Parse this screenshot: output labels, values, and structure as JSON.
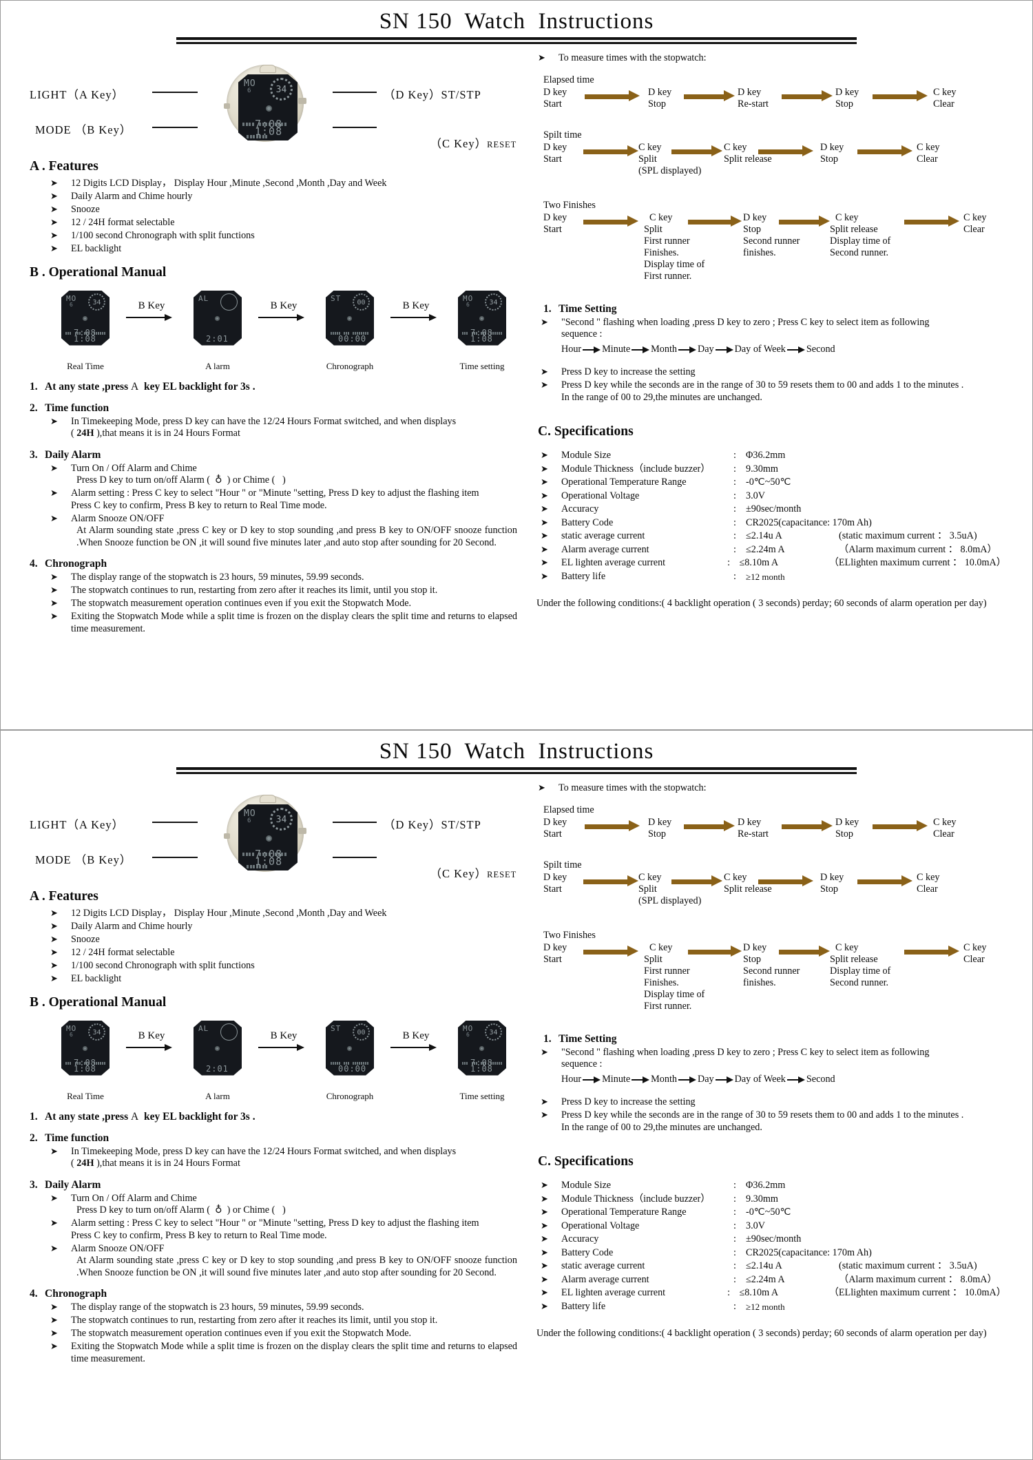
{
  "page": {
    "title": "SN 150  Watch  Instructions",
    "callout": {
      "light_label": "LIGHT（A Key）",
      "mode_label": "MODE （B Key）",
      "d_label": "（D Key）ST/STP",
      "c_label": "（C Key）",
      "c_label_small": "RESET",
      "lcd": {
        "mode_text": "MO",
        "small_text": "6",
        "ring_text": "34",
        "time_text": "7:08",
        "time_text2": "1:08"
      }
    },
    "features": {
      "heading": "A . Features",
      "items": [
        "12 Digits LCD Display， Display Hour ,Minute ,Second ,Month ,Day and Week",
        "Daily Alarm and Chime hourly",
        "Snooze",
        "12 / 24H format selectable",
        "1/100 second Chronograph with split functions",
        "EL backlight"
      ]
    },
    "manual": {
      "heading": "B . Operational Manual",
      "flow": [
        {
          "caption": "Real Time",
          "mode": "MO",
          "small": "6",
          "ring": "34",
          "time": "7:08",
          "time2": "1:08",
          "dotted": true
        },
        {
          "caption": "A larm",
          "mode": "AL",
          "small": "",
          "ring": "",
          "time": "2:01",
          "time2": "",
          "dotted": false
        },
        {
          "caption": "Chronograph",
          "mode": "ST",
          "small": "",
          "ring": "00",
          "time": "00:00",
          "time2": "",
          "dotted": true
        },
        {
          "caption": "Time setting",
          "mode": "MO",
          "small": "6",
          "ring": "34",
          "time": "7:08",
          "time2": "1:08",
          "dotted": true
        }
      ],
      "arrow_keys": [
        "B Key",
        "B Key",
        "B Key"
      ],
      "item1": {
        "num": "1.",
        "text_a": "At any state ,press",
        "key": "A",
        "text_b": "key EL backlight for 3s ."
      },
      "item2": {
        "num": "2.",
        "heading": "Time function",
        "line1": "In Timekeeping Mode, press D key can have the 12/24 Hours Format switched, and when displays",
        "line2_pre": "(",
        "line2_bold": "24H",
        "line2_post": "),that means it is in 24 Hours Format"
      },
      "item3": {
        "num": "3.",
        "heading": "Daily Alarm",
        "b1": "Turn On / Off Alarm and Chime",
        "b1sub_pre": "Press  D  key to turn on/off Alarm (",
        "b1sub_icon": "♁",
        "b1sub_mid": ") or Chime (",
        "b1sub_post": ")",
        "b2_l1": "Alarm setting : Press C key to select \"Hour \" or \"Minute \"setting, Press D key to adjust the flashing item",
        "b2_l2": "Press C key to confirm, Press  B  key to return to Real Time mode.",
        "b3": "Alarm Snooze ON/OFF",
        "b3sub": "At Alarm sounding state ,press  C  key or D key to stop sounding ,and press B key to ON/OFF snooze function .When Snooze function be ON ,it will sound five minutes later ,and auto stop after sounding for 20 Second."
      },
      "item4": {
        "num": "4.",
        "heading": "Chronograph",
        "items": [
          "The display range of the stopwatch is 23 hours, 59 minutes, 59.99 seconds.",
          "The stopwatch continues to run, restarting from zero after it reaches its limit, until you stop it.",
          "The stopwatch measurement operation continues even if you exit the Stopwatch Mode.",
          "Exiting the Stopwatch Mode while a split time is frozen on the display clears the split time and returns to elapsed time measurement."
        ]
      }
    },
    "stopwatch": {
      "intro": "To measure times with the stopwatch:",
      "groups": [
        {
          "label": "Elapsed time",
          "steps": [
            {
              "key": "D key",
              "action": "Start",
              "notes": []
            },
            {
              "key": "D key",
              "action": "Stop",
              "notes": []
            },
            {
              "key": "D key",
              "action": "Re-start",
              "notes": []
            },
            {
              "key": "D key",
              "action": "Stop",
              "notes": []
            },
            {
              "key": "C key",
              "action": "Clear",
              "notes": []
            }
          ]
        },
        {
          "label": "Spilt time",
          "steps": [
            {
              "key": "D key",
              "action": "Start",
              "notes": []
            },
            {
              "key": "C key",
              "action": "Split",
              "notes": [
                "(SPL displayed)"
              ]
            },
            {
              "key": "C key",
              "action": "Split release",
              "notes": []
            },
            {
              "key": "D key",
              "action": "Stop",
              "notes": []
            },
            {
              "key": "C key",
              "action": "Clear",
              "notes": []
            }
          ]
        },
        {
          "label": "Two Finishes",
          "steps": [
            {
              "key": "D key",
              "action": "Start",
              "notes": []
            },
            {
              "key": "C key",
              "action": "Split",
              "notes": [
                "First runner",
                "Finishes.",
                "Display time of",
                "First runner."
              ]
            },
            {
              "key": "D key",
              "action": "Stop",
              "notes": [
                "Second runner",
                "finishes."
              ]
            },
            {
              "key": "C key",
              "action": "Split release",
              "notes": [
                "Display time of",
                "Second runner."
              ]
            },
            {
              "key": "C key",
              "action": "Clear",
              "notes": []
            }
          ]
        }
      ],
      "arrow_color": "#8a6118"
    },
    "time_setting": {
      "num": "1.",
      "heading": "Time Setting",
      "b1_l1": "\"Second \"  flashing  when  loading ,press  D  key  to  zero ;    Press  C  key  to  select  item  as  following",
      "b1_l2": "sequence :",
      "sequence": [
        "Hour",
        "Minute",
        "Month",
        "Day",
        "Day of   Week",
        "Second"
      ],
      "b2": "Press D key to increase the setting",
      "b3_l1": "Press D key while the seconds are in the range of 30 to 59 resets them to 00 and adds 1 to the minutes .",
      "b3_l2": "In the range of 00 to 29,the minutes are unchanged."
    },
    "specifications": {
      "heading": "C. Specifications",
      "rows": [
        {
          "name": "Module Size",
          "colon": ":",
          "value": "Φ36.2mm",
          "extra": ""
        },
        {
          "name": "Module Thickness（include buzzer）",
          "colon": ":",
          "value": "9.30mm",
          "extra": ""
        },
        {
          "name": "Operational Temperature Range",
          "colon": ":",
          "value": "-0℃~50℃",
          "extra": ""
        },
        {
          "name": "Operational Voltage",
          "colon": ":",
          "value": "3.0V",
          "extra": ""
        },
        {
          "name": "Accuracy",
          "colon": ":",
          "value": "±90sec/month",
          "extra": ""
        },
        {
          "name": "Battery Code",
          "colon": ":",
          "value": "CR2025(capacitance: 170m Ah)",
          "extra": ""
        },
        {
          "name": "static average current",
          "colon": ":",
          "value": "≤2.14u A",
          "extra": "(static maximum current ： 3.5uA)"
        },
        {
          "name": "Alarm average current",
          "colon": ":",
          "value": "≤2.24m A",
          "extra": "（Alarm maximum current ： 8.0mA）"
        },
        {
          "name": "EL lighten average current",
          "colon": ":",
          "value": "≤8.10m A",
          "extra": "（ELlighten maximum current ： 10.0mA）"
        },
        {
          "name": "Battery life",
          "colon": ":",
          "value": "≥12 month",
          "extra": ""
        }
      ],
      "conditions": "Under the following conditions:( 4 backlight operation ( 3 seconds) perday; 60 seconds of alarm operation per day)"
    }
  }
}
